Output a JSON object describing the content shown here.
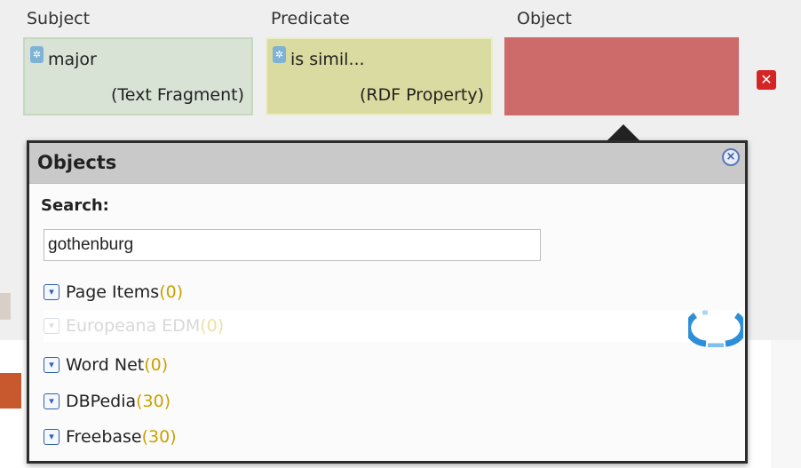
{
  "columns": {
    "subject": "Subject",
    "predicate": "Predicate",
    "object": "Object"
  },
  "subject": {
    "value": "major",
    "type": "(Text Fragment)",
    "color": "#d8e3d5"
  },
  "predicate": {
    "value": "is simil...",
    "type": "(RDF Property)",
    "color": "#dadba0"
  },
  "object": {
    "value": "",
    "color": "#cd6b6b"
  },
  "delete_icon": "close-x-icon",
  "popup": {
    "title": "Objects",
    "close_icon": "circle-x-icon",
    "search_label": "Search:",
    "search_value": "gothenburg",
    "sources": [
      {
        "name": "Page Items",
        "count": "(0)",
        "loading": false
      },
      {
        "name": "Europeana EDM",
        "count": "(0)",
        "loading": true
      },
      {
        "name": "Word Net",
        "count": "(0)",
        "loading": false
      },
      {
        "name": "DBPedia",
        "count": "(30)",
        "loading": false
      },
      {
        "name": "Freebase",
        "count": "(30)",
        "loading": false
      }
    ]
  },
  "colors": {
    "accent_count": "#c9a200",
    "expand_icon": "#2f5fb0",
    "spinner": "#2d8fd8"
  }
}
